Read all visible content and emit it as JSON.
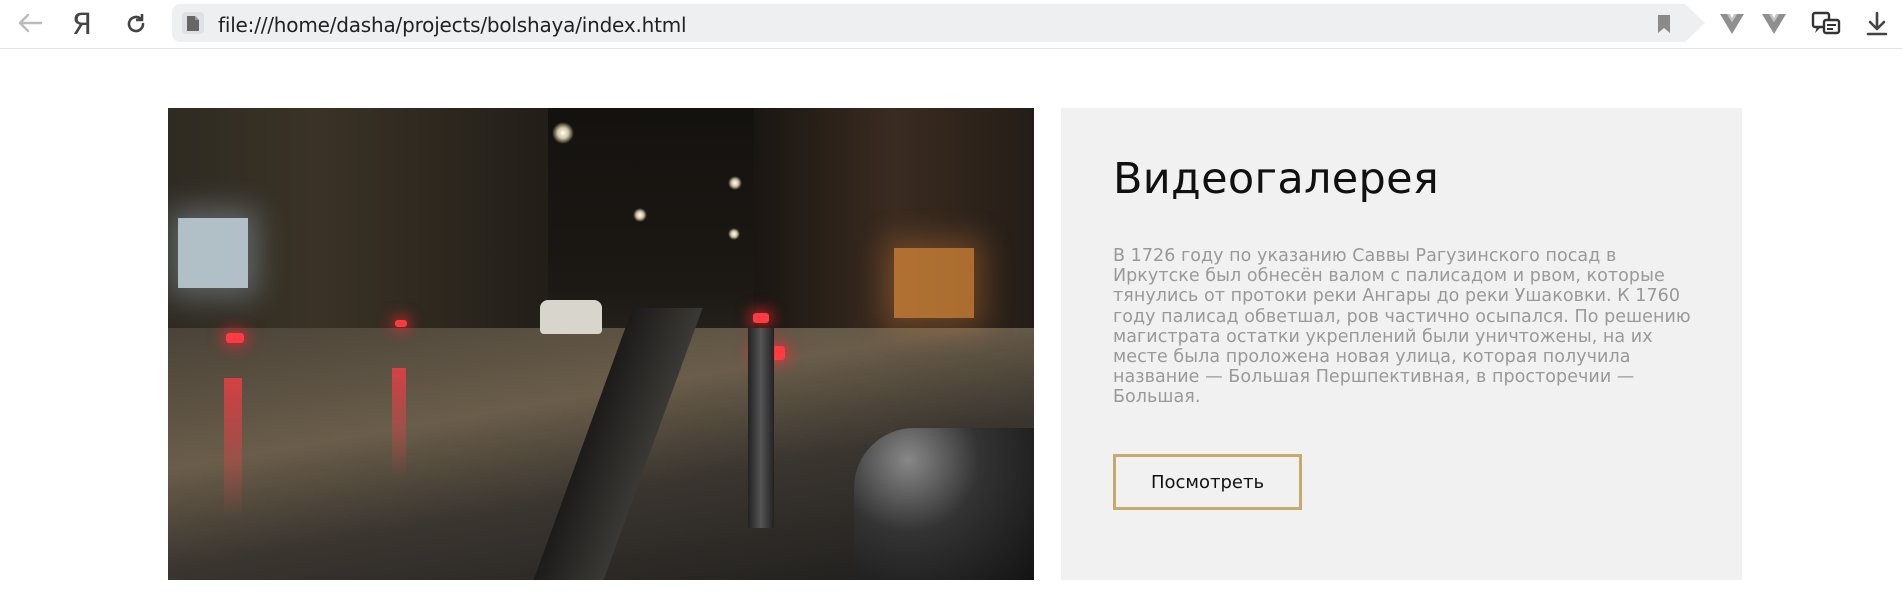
{
  "browser": {
    "url": "file:///home/dasha/projects/bolshaya/index.html",
    "yandex_glyph": "Я",
    "icons": {
      "back": "back-arrow-icon",
      "home": "yandex-icon",
      "reload": "reload-icon",
      "page": "page-file-icon",
      "bookmark": "bookmark-icon",
      "ext1": "vue-devtools-icon",
      "ext2": "vue-devtools-icon",
      "ext3": "translate-chat-icon",
      "download": "download-icon"
    }
  },
  "gallery": {
    "title": "Видеогалерея",
    "description": "В 1726 году по указанию Саввы Рагузинского посад в Иркутске был обнесён валом с палисадом и рвом, которые тянулись от протоки реки Ангары до реки Ушаковки. К 1760 году палисад обветшал, ров частично осыпался. По решению магистрата остатки укреплений были уничтожены, на их месте была проложена новая улица, которая получила название — Большая Першпективная, в просторечии — Большая.",
    "button_label": "Посмотреть",
    "accent_color": "#c8aa6e",
    "panel_color": "#f1f1f1",
    "video_scene": "night-street-video-still"
  }
}
